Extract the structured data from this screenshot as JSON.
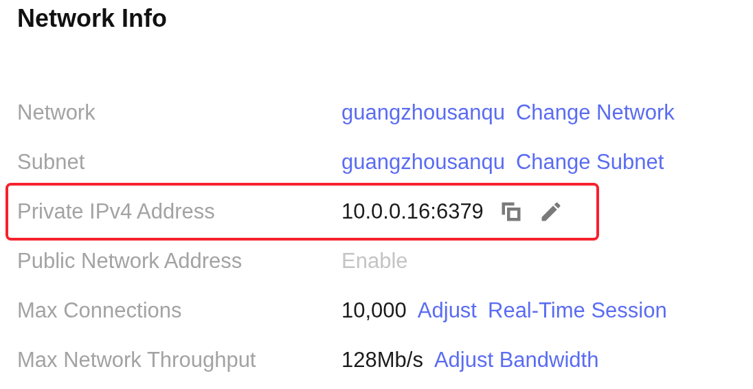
{
  "title": "Network Info",
  "rows": [
    {
      "label": "Network",
      "highlighted": false,
      "items": [
        {
          "kind": "link",
          "text": "guangzhousanqu"
        },
        {
          "kind": "link",
          "text": "Change Network"
        }
      ]
    },
    {
      "label": "Subnet",
      "highlighted": false,
      "items": [
        {
          "kind": "link",
          "text": "guangzhousanqu"
        },
        {
          "kind": "link",
          "text": "Change Subnet"
        }
      ]
    },
    {
      "label": "Private IPv4 Address",
      "highlighted": true,
      "items": [
        {
          "kind": "text",
          "text": "10.0.0.16:6379"
        },
        {
          "kind": "copy"
        },
        {
          "kind": "edit"
        }
      ]
    },
    {
      "label": "Public Network Address",
      "highlighted": false,
      "items": [
        {
          "kind": "disabled",
          "text": "Enable"
        }
      ]
    },
    {
      "label": "Max Connections",
      "highlighted": false,
      "items": [
        {
          "kind": "text",
          "text": "10,000"
        },
        {
          "kind": "link",
          "text": "Adjust"
        },
        {
          "kind": "link",
          "text": "Real-Time Session"
        }
      ]
    },
    {
      "label": "Max Network Throughput",
      "highlighted": false,
      "items": [
        {
          "kind": "text",
          "text": "128Mb/s"
        },
        {
          "kind": "link",
          "text": "Adjust Bandwidth"
        }
      ]
    }
  ]
}
